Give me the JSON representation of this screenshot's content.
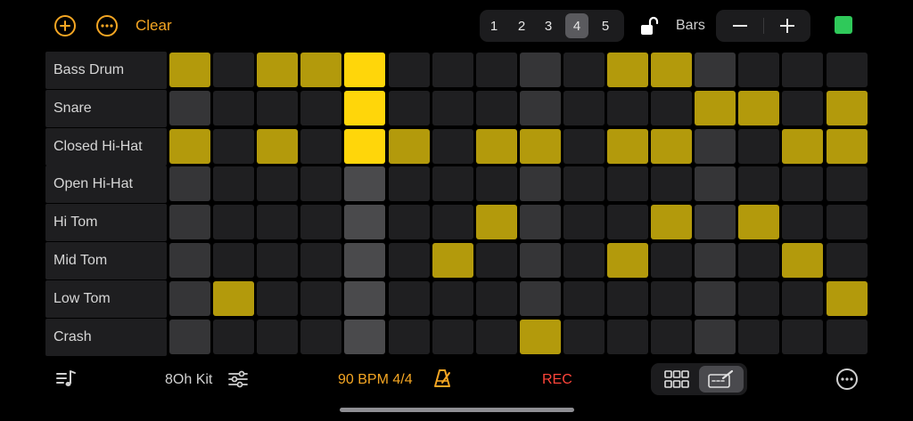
{
  "toolbar": {
    "clear_label": "Clear",
    "bars_label": "Bars",
    "bar_options": [
      "1",
      "2",
      "3",
      "4",
      "5"
    ],
    "selected_bar": "4",
    "add_icon": "plus-circle-icon",
    "more_icon": "ellipsis-circle-icon",
    "lock_icon": "lock-open-icon",
    "decrement_icon": "minus-icon",
    "increment_icon": "plus-icon",
    "color_swatch": "#2fc95a"
  },
  "sequencer": {
    "steps": 16,
    "playhead_step": 4,
    "beat_steps": [
      0,
      4,
      8,
      12
    ],
    "active_color": "#b39a0c",
    "playhead_active_color": "#ffd60a",
    "tracks": [
      {
        "name": "Bass Drum",
        "pattern": [
          1,
          0,
          1,
          1,
          1,
          0,
          0,
          0,
          0,
          0,
          1,
          1,
          0,
          0,
          0,
          0
        ]
      },
      {
        "name": "Snare",
        "pattern": [
          0,
          0,
          0,
          0,
          1,
          0,
          0,
          0,
          0,
          0,
          0,
          0,
          1,
          1,
          0,
          1
        ]
      },
      {
        "name": "Closed Hi-Hat",
        "pattern": [
          1,
          0,
          1,
          0,
          1,
          1,
          0,
          1,
          1,
          0,
          1,
          1,
          0,
          0,
          1,
          1
        ]
      },
      {
        "name": "Open Hi-Hat",
        "pattern": [
          0,
          0,
          0,
          0,
          0,
          0,
          0,
          0,
          0,
          0,
          0,
          0,
          0,
          0,
          0,
          0
        ]
      },
      {
        "name": "Hi Tom",
        "pattern": [
          0,
          0,
          0,
          0,
          0,
          0,
          0,
          1,
          0,
          0,
          0,
          1,
          0,
          1,
          0,
          0
        ]
      },
      {
        "name": "Mid Tom",
        "pattern": [
          0,
          0,
          0,
          0,
          0,
          0,
          1,
          0,
          0,
          0,
          1,
          0,
          0,
          0,
          1,
          0
        ]
      },
      {
        "name": "Low Tom",
        "pattern": [
          0,
          1,
          0,
          0,
          0,
          0,
          0,
          0,
          0,
          0,
          0,
          0,
          0,
          0,
          0,
          1
        ]
      },
      {
        "name": "Crash",
        "pattern": [
          0,
          0,
          0,
          0,
          0,
          0,
          0,
          0,
          1,
          0,
          0,
          0,
          0,
          0,
          0,
          0
        ]
      }
    ]
  },
  "bottom": {
    "kit_label": "8Oh Kit",
    "tempo_label": "90 BPM 4/4",
    "rec_label": "REC",
    "track_list_icon": "music-list-icon",
    "kit_settings_icon": "sliders-icon",
    "metronome_icon": "metronome-icon",
    "grid_view_icon": "grid-view-icon",
    "editor_view_icon": "pencil-editor-icon",
    "selected_view": "editor",
    "more_icon": "ellipsis-circle-icon"
  }
}
